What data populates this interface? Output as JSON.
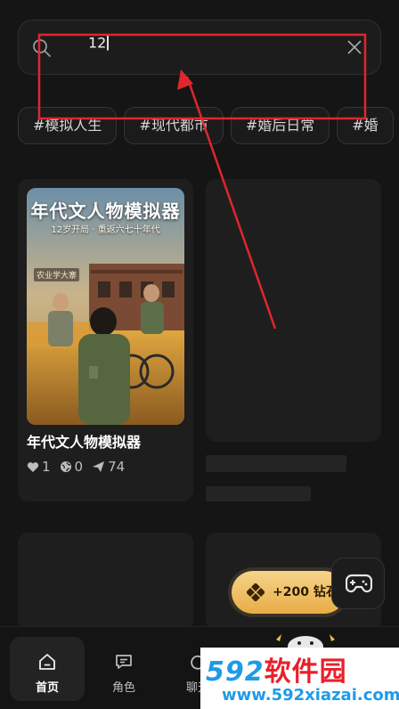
{
  "search": {
    "value": "12",
    "placeholder": ""
  },
  "tags": [
    "#模拟人生",
    "#现代都市",
    "#婚后日常",
    "#婚"
  ],
  "cards": [
    {
      "title": "年代文人物模拟器",
      "cover_title": "年代文人物模拟器",
      "cover_subtitle": "12岁开局 · 重返六七十年代",
      "cover_sign": "农业学大寨",
      "likes": "1",
      "shares": "0",
      "plays": "74"
    }
  ],
  "promo": {
    "label": "+200 钻石"
  },
  "nav": [
    {
      "label": "首页",
      "icon": "home-icon",
      "active": true
    },
    {
      "label": "角色",
      "icon": "chat-bubble-icon",
      "active": false
    },
    {
      "label": "聊天",
      "icon": "refresh-icon",
      "active": false
    }
  ],
  "watermark": {
    "brand_num": "592",
    "brand_cn": "软件园",
    "url": "www.592xiazai.com"
  },
  "colors": {
    "background": "#151515",
    "card": "#1e1e1e",
    "accent_gold": "#f0c068",
    "annotation_red": "#e0262e"
  }
}
